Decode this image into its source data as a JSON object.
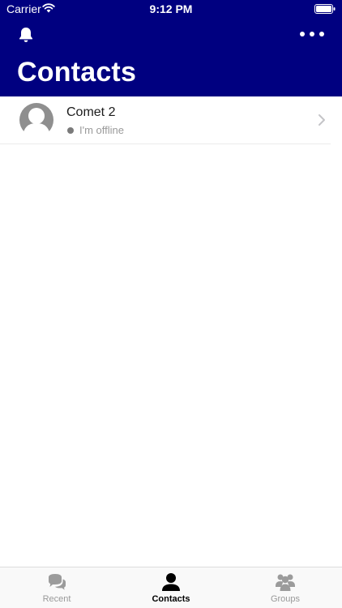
{
  "status_bar": {
    "carrier": "Carrier",
    "time": "9:12 PM"
  },
  "header": {
    "title": "Contacts",
    "background_color": "#000080",
    "left_icon": "bell-icon",
    "right_icon": "more-icon"
  },
  "contacts": [
    {
      "name": "Comet 2",
      "status": "I'm offline",
      "presence": "offline",
      "avatar": "default-avatar-icon"
    }
  ],
  "tab_bar": {
    "tabs": [
      {
        "label": "Recent",
        "icon": "chat-bubbles-icon",
        "active": false
      },
      {
        "label": "Contacts",
        "icon": "person-icon",
        "active": true
      },
      {
        "label": "Groups",
        "icon": "group-icon",
        "active": false
      }
    ]
  }
}
